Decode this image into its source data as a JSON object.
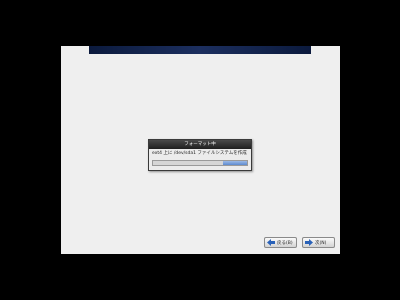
{
  "dialog": {
    "title": "フォーマット中",
    "message": "ext4 上に /dev/sda1 ファイルシステムを作成",
    "progress": 0.26
  },
  "nav": {
    "back_label": "戻る(B)",
    "next_label": "次(N)"
  },
  "colors": {
    "screen_bg": "#000000",
    "window_bg": "#efefef",
    "banner": "#1c2f5f",
    "progress_fill": "#5e8bd0",
    "arrow_icon": "#2a62b8"
  },
  "icons": {
    "back": "arrow-left-icon",
    "next": "arrow-right-icon"
  }
}
